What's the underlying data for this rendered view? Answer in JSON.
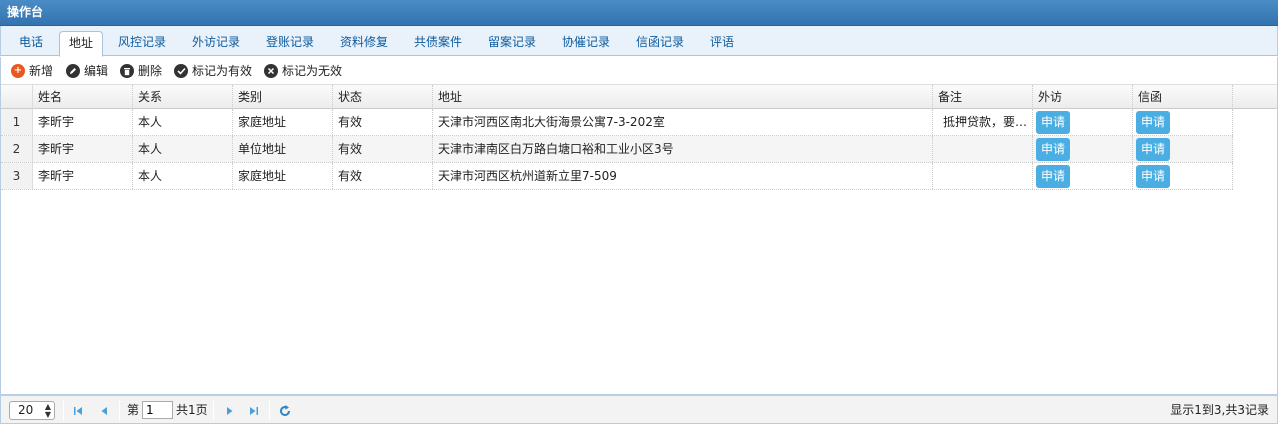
{
  "panel": {
    "title": "操作台"
  },
  "tabs": [
    "电话",
    "地址",
    "风控记录",
    "外访记录",
    "登账记录",
    "资料修复",
    "共债案件",
    "留案记录",
    "协催记录",
    "信函记录",
    "评语"
  ],
  "toolbar": {
    "add": "新增",
    "edit": "编辑",
    "delete": "删除",
    "mark_valid": "标记为有效",
    "mark_invalid": "标记为无效"
  },
  "table": {
    "columns": [
      "姓名",
      "关系",
      "类别",
      "状态",
      "地址",
      "备注",
      "外访",
      "信函"
    ],
    "rows": [
      {
        "num": "1",
        "name": "李昕宇",
        "relation": "本人",
        "category": "家庭地址",
        "status": "有效",
        "address": "天津市河西区南北大街海景公寓7-3-202室",
        "note": "抵押贷款，要…",
        "visit": "申请",
        "letter": "申请"
      },
      {
        "num": "2",
        "name": "李昕宇",
        "relation": "本人",
        "category": "单位地址",
        "status": "有效",
        "address": "天津市津南区白万路白塘口裕和工业小区3号",
        "note": "",
        "visit": "申请",
        "letter": "申请"
      },
      {
        "num": "3",
        "name": "李昕宇",
        "relation": "本人",
        "category": "家庭地址",
        "status": "有效",
        "address": "天津市河西区杭州道新立里7-509",
        "note": "",
        "visit": "申请",
        "letter": "申请"
      }
    ]
  },
  "pager": {
    "page_size": "20",
    "page_prefix": "第",
    "page_value": "1",
    "page_total": "共1页",
    "info": "显示1到3,共3记录"
  },
  "colors": {
    "header": "#3a7cb9",
    "accent": "#4aaee3",
    "link": "#0c5b9e"
  }
}
